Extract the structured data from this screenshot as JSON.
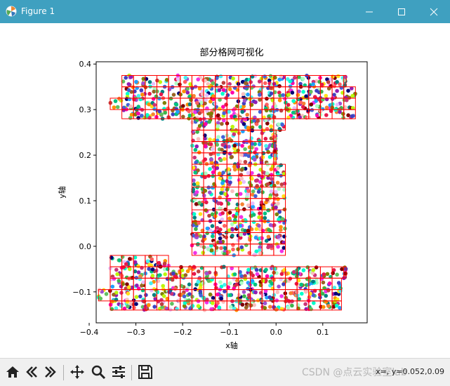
{
  "window": {
    "title": "Figure 1"
  },
  "toolbar": {
    "items": [
      "home-icon",
      "back-icon",
      "forward-icon",
      "pan-icon",
      "zoom-icon",
      "configure-icon",
      "save-icon"
    ],
    "coords_text": "x=, y=0.052,0.09",
    "watermark": "CSDN @点云实验室lab"
  },
  "chart_data": {
    "type": "scatter",
    "title": "部分格网可视化",
    "xlabel": "x轴",
    "ylabel": "y轴",
    "xlim": [
      -0.385,
      0.195
    ],
    "ylim": [
      -0.168,
      0.405
    ],
    "xticks": [
      -0.4,
      -0.3,
      -0.2,
      -0.1,
      0.0,
      0.1
    ],
    "xtick_labels": [
      "−0.4",
      "−0.3",
      "−0.2",
      "−0.1",
      "0.0",
      "0.1"
    ],
    "yticks": [
      -0.1,
      0.0,
      0.1,
      0.2,
      0.3,
      0.4
    ],
    "ytick_labels": [
      "−0.1",
      "0.0",
      "0.1",
      "0.2",
      "0.3",
      "0.4"
    ],
    "grid_cell_size": 0.025,
    "grid_color": "#ff0000",
    "grid_regions": [
      {
        "x": [
          -0.33,
          0.15
        ],
        "y": [
          0.35,
          0.375
        ]
      },
      {
        "x": [
          -0.33,
          0.17
        ],
        "y": [
          0.325,
          0.35
        ]
      },
      {
        "x": [
          -0.355,
          0.17
        ],
        "y": [
          0.3,
          0.325
        ]
      },
      {
        "x": [
          -0.33,
          0.17
        ],
        "y": [
          0.28,
          0.3
        ]
      },
      {
        "x": [
          -0.18,
          0.02
        ],
        "y": [
          0.255,
          0.28
        ]
      },
      {
        "x": [
          -0.18,
          0.0
        ],
        "y": [
          0.18,
          0.255
        ]
      },
      {
        "x": [
          -0.18,
          0.02
        ],
        "y": [
          -0.02,
          0.18
        ]
      },
      {
        "x": [
          -0.355,
          -0.23
        ],
        "y": [
          -0.045,
          -0.02
        ]
      },
      {
        "x": [
          -0.355,
          0.15
        ],
        "y": [
          -0.07,
          -0.045
        ]
      },
      {
        "x": [
          -0.355,
          0.14
        ],
        "y": [
          -0.095,
          -0.07
        ]
      },
      {
        "x": [
          -0.38,
          0.14
        ],
        "y": [
          -0.12,
          -0.095
        ]
      },
      {
        "x": [
          -0.355,
          0.14
        ],
        "y": [
          -0.14,
          -0.12
        ]
      }
    ]
  }
}
